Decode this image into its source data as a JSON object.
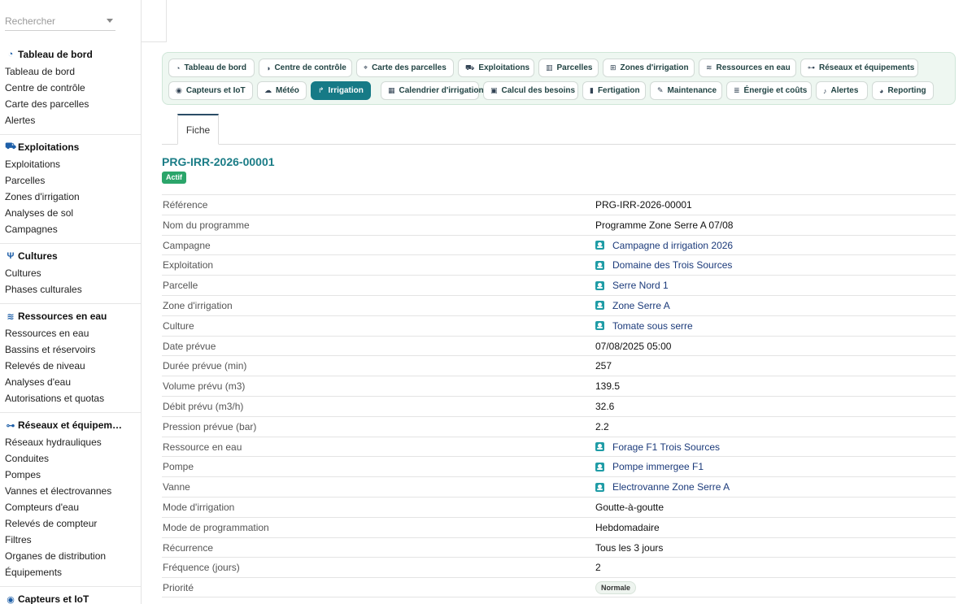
{
  "search": {
    "placeholder": "Rechercher"
  },
  "sidebar": {
    "sections": [
      {
        "title": "Tableau de bord",
        "icon": "gauge-icon",
        "items": [
          "Tableau de bord",
          "Centre de contrôle",
          "Carte des parcelles",
          "Alertes"
        ]
      },
      {
        "title": "Exploitations",
        "icon": "tractor-icon",
        "items": [
          "Exploitations",
          "Parcelles",
          "Zones d'irrigation",
          "Analyses de sol",
          "Campagnes"
        ]
      },
      {
        "title": "Cultures",
        "icon": "seedling-icon",
        "items": [
          "Cultures",
          "Phases culturales"
        ]
      },
      {
        "title": "Ressources en eau",
        "icon": "water-icon",
        "items": [
          "Ressources en eau",
          "Bassins et réservoirs",
          "Relevés de niveau",
          "Analyses d'eau",
          "Autorisations et quotas"
        ]
      },
      {
        "title": "Réseaux et équipem…",
        "icon": "network-icon",
        "items": [
          "Réseaux hydrauliques",
          "Conduites",
          "Pompes",
          "Vannes et électrovannes",
          "Compteurs d'eau",
          "Relevés de compteur",
          "Filtres",
          "Organes de distribution",
          "Équipements"
        ]
      },
      {
        "title": "Capteurs et IoT",
        "icon": "sensor-icon",
        "items": []
      }
    ]
  },
  "toolbar": {
    "row1": [
      {
        "label": "Tableau de bord",
        "icon": "gauge-icon"
      },
      {
        "label": "Centre de contrôle",
        "icon": "dial-icon"
      },
      {
        "label": "Carte des parcelles",
        "icon": "map-pin-icon"
      },
      {
        "label": "Exploitations",
        "icon": "tractor-icon"
      },
      {
        "label": "Parcelles",
        "icon": "map-icon"
      },
      {
        "label": "Zones d'irrigation",
        "icon": "sitemap-icon"
      },
      {
        "label": "Ressources en eau",
        "icon": "water-icon"
      },
      {
        "label": "Réseaux et équipements",
        "icon": "network-icon"
      }
    ],
    "row2": [
      {
        "label": "Capteurs et IoT",
        "icon": "sensor-icon"
      },
      {
        "label": "Météo",
        "icon": "cloud-sun-icon"
      },
      {
        "label": "Irrigation",
        "icon": "faucet-icon",
        "active": true
      },
      {
        "label": "Calendrier d'irrigation",
        "icon": "calendar-icon"
      },
      {
        "label": "Calcul des besoins",
        "icon": "calculator-icon"
      },
      {
        "label": "Fertigation",
        "icon": "flask-icon"
      },
      {
        "label": "Maintenance",
        "icon": "wrench-icon"
      },
      {
        "label": "Énergie et coûts",
        "icon": "coins-icon"
      },
      {
        "label": "Alertes",
        "icon": "bell-icon"
      },
      {
        "label": "Reporting",
        "icon": "chart-pie-icon"
      }
    ]
  },
  "tabs": {
    "fiche": "Fiche"
  },
  "record": {
    "title": "PRG-IRR-2026-00001",
    "status": "Actif",
    "fields": [
      {
        "label": "Référence",
        "value": "PRG-IRR-2026-00001",
        "type": "text"
      },
      {
        "label": "Nom du programme",
        "value": "Programme Zone Serre A 07/08",
        "type": "text"
      },
      {
        "label": "Campagne",
        "value": "Campagne d irrigation 2026",
        "type": "link"
      },
      {
        "label": "Exploitation",
        "value": "Domaine des Trois Sources",
        "type": "link"
      },
      {
        "label": "Parcelle",
        "value": "Serre Nord 1",
        "type": "link"
      },
      {
        "label": "Zone d'irrigation",
        "value": "Zone Serre A",
        "type": "link"
      },
      {
        "label": "Culture",
        "value": "Tomate sous serre",
        "type": "link"
      },
      {
        "label": "Date prévue",
        "value": "07/08/2025 05:00",
        "type": "text"
      },
      {
        "label": "Durée prévue (min)",
        "value": "257",
        "type": "text"
      },
      {
        "label": "Volume prévu (m3)",
        "value": "139.5",
        "type": "text"
      },
      {
        "label": "Débit prévu (m3/h)",
        "value": "32.6",
        "type": "text"
      },
      {
        "label": "Pression prévue (bar)",
        "value": "2.2",
        "type": "text"
      },
      {
        "label": "Ressource en eau",
        "value": "Forage F1 Trois Sources",
        "type": "link"
      },
      {
        "label": "Pompe",
        "value": "Pompe immergee F1",
        "type": "link"
      },
      {
        "label": "Vanne",
        "value": "Electrovanne Zone Serre A",
        "type": "link"
      },
      {
        "label": "Mode d'irrigation",
        "value": "Goutte-à-goutte",
        "type": "text"
      },
      {
        "label": "Mode de programmation",
        "value": "Hebdomadaire",
        "type": "text"
      },
      {
        "label": "Récurrence",
        "value": "Tous les 3 jours",
        "type": "text"
      },
      {
        "label": "Fréquence (jours)",
        "value": "2",
        "type": "text"
      },
      {
        "label": "Priorité",
        "value": "Normale",
        "type": "pill"
      }
    ]
  }
}
